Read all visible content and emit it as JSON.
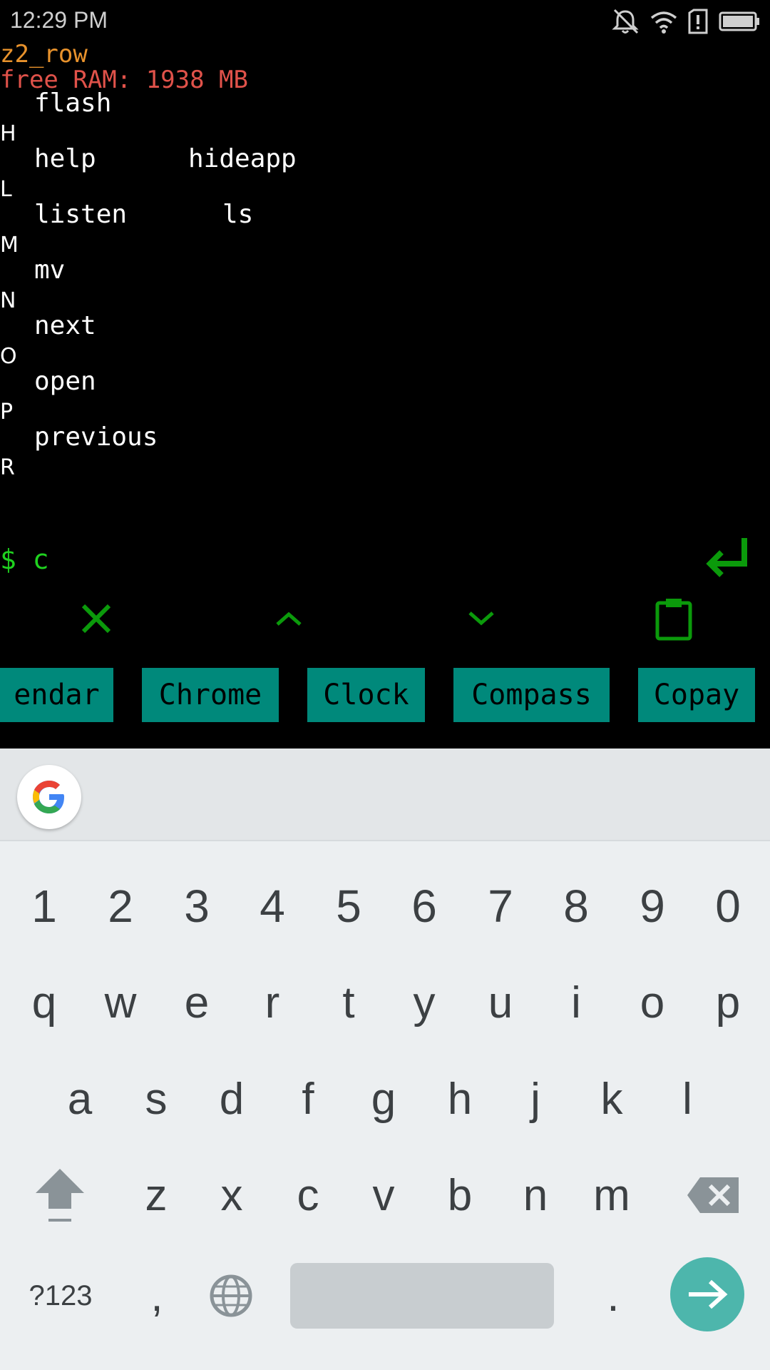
{
  "status_bar": {
    "time": "12:29 PM",
    "icons": [
      "mute-icon",
      "wifi-icon",
      "alert-icon",
      "battery-icon"
    ]
  },
  "terminal": {
    "device_name": "z2_row",
    "free_ram": "free RAM: 1938 MB",
    "listing": [
      {
        "letter": "",
        "commands": [
          "flash"
        ]
      },
      {
        "letter": "H",
        "commands": [
          "help",
          "hideapp"
        ]
      },
      {
        "letter": "L",
        "commands": [
          "listen",
          "ls"
        ]
      },
      {
        "letter": "M",
        "commands": [
          "mv"
        ]
      },
      {
        "letter": "N",
        "commands": [
          "next"
        ]
      },
      {
        "letter": "O",
        "commands": [
          "open"
        ]
      },
      {
        "letter": "P",
        "commands": [
          "previous"
        ]
      },
      {
        "letter": "R",
        "commands": []
      }
    ],
    "prompt_symbol": "$",
    "input_value": "c"
  },
  "toolbar": {
    "icons": [
      "close-icon",
      "chevron-up-icon",
      "chevron-down-icon",
      "clipboard-icon"
    ],
    "enter_icon": "enter-icon"
  },
  "app_suggestions": [
    "endar",
    "Chrome",
    "Clock",
    "Compass",
    "Copay"
  ],
  "colors": {
    "terminal_bg": "#000000",
    "device_name": "#e8922c",
    "ram": "#e0524a",
    "prompt": "#1fd21f",
    "toolbar_icons": "#0b9a0b",
    "app_button": "#00897b",
    "keyboard_bg": "#eceff1",
    "go_key": "#4db6ac"
  },
  "keyboard": {
    "numbers": [
      "1",
      "2",
      "3",
      "4",
      "5",
      "6",
      "7",
      "8",
      "9",
      "0"
    ],
    "row1": [
      "q",
      "w",
      "e",
      "r",
      "t",
      "y",
      "u",
      "i",
      "o",
      "p"
    ],
    "row2": [
      "a",
      "s",
      "d",
      "f",
      "g",
      "h",
      "j",
      "k",
      "l"
    ],
    "row3": [
      "z",
      "x",
      "c",
      "v",
      "b",
      "n",
      "m"
    ],
    "symbols_key": "?123",
    "comma_key": ",",
    "period_key": "."
  }
}
